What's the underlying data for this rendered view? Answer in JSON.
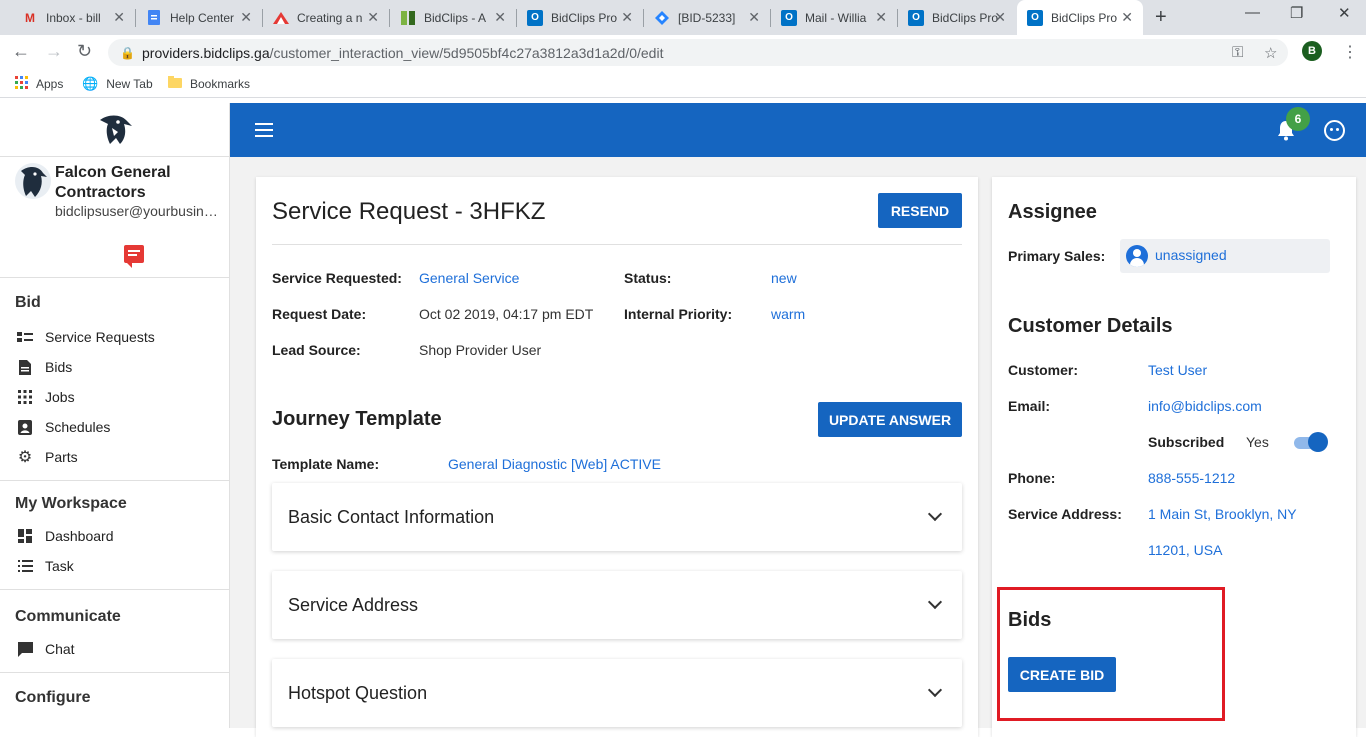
{
  "browser": {
    "tabs": [
      {
        "title": "Inbox - bill",
        "favicon": "gmail-icon"
      },
      {
        "title": "Help Center",
        "favicon": "docs-icon"
      },
      {
        "title": "Creating a n",
        "favicon": "triangle-icon"
      },
      {
        "title": "BidClips - A",
        "favicon": "bidclips-icon"
      },
      {
        "title": "BidClips Pro",
        "favicon": "outlook-icon"
      },
      {
        "title": "[BID-5233]",
        "favicon": "jira-icon"
      },
      {
        "title": "Mail - Willia",
        "favicon": "outlook-icon"
      },
      {
        "title": "BidClips Pro",
        "favicon": "outlook-icon"
      },
      {
        "title": "BidClips Pro",
        "favicon": "outlook-icon"
      }
    ],
    "url_host": "providers.bidclips.ga",
    "url_path": "/customer_interaction_view/5d9505bf4c27a3812a3d1a2d/0/edit",
    "profile_initial": "B",
    "bookmarks": [
      {
        "label": "Apps",
        "icon": "apps-grid-icon"
      },
      {
        "label": "New Tab",
        "icon": "globe-icon"
      },
      {
        "label": "Bookmarks",
        "icon": "folder-icon"
      }
    ]
  },
  "sidebar": {
    "company": "Falcon General Contractors",
    "email": "bidclipsuser@yourbusiness.com",
    "sections": [
      {
        "title": "Bid",
        "items": [
          {
            "label": "Service Requests",
            "icon": "list-icon"
          },
          {
            "label": "Bids",
            "icon": "document-icon"
          },
          {
            "label": "Jobs",
            "icon": "grid-icon"
          },
          {
            "label": "Schedules",
            "icon": "contact-icon"
          },
          {
            "label": "Parts",
            "icon": "gear-icon"
          }
        ]
      },
      {
        "title": "My Workspace",
        "items": [
          {
            "label": "Dashboard",
            "icon": "dashboard-icon"
          },
          {
            "label": "Task",
            "icon": "task-list-icon"
          }
        ]
      },
      {
        "title": "Communicate",
        "items": [
          {
            "label": "Chat",
            "icon": "chat-icon"
          }
        ]
      },
      {
        "title": "Configure",
        "items": []
      }
    ]
  },
  "topbar": {
    "notification_count": "6",
    "accent": "#1565c0"
  },
  "request": {
    "title": "Service Request - 3HFKZ",
    "resend_label": "RESEND",
    "fields": {
      "service_requested_label": "Service Requested:",
      "service_requested_value": "General Service",
      "status_label": "Status:",
      "status_value": "new",
      "request_date_label": "Request Date:",
      "request_date_value": "Oct 02 2019, 04:17 pm EDT",
      "priority_label": "Internal Priority:",
      "priority_value": "warm",
      "lead_source_label": "Lead Source:",
      "lead_source_value": "Shop Provider User"
    },
    "journey": {
      "title": "Journey Template",
      "update_label": "UPDATE ANSWER",
      "template_label": "Template Name:",
      "template_value": "General Diagnostic [Web] ACTIVE"
    },
    "accordions": [
      "Basic Contact Information",
      "Service Address",
      "Hotspot Question"
    ]
  },
  "side": {
    "assignee_title": "Assignee",
    "primary_sales_label": "Primary Sales:",
    "primary_sales_value": "unassigned",
    "customer_title": "Customer Details",
    "customer_label": "Customer:",
    "customer_value": "Test User",
    "email_label": "Email:",
    "email_value": "info@bidclips.com",
    "subscribed_label": "Subscribed",
    "subscribed_value": "Yes",
    "phone_label": "Phone:",
    "phone_value": "888-555-1212",
    "address_label": "Service Address:",
    "address_line1": "1 Main St, Brooklyn, NY",
    "address_line2": "11201, USA",
    "bids_title": "Bids",
    "create_bid_label": "CREATE BID"
  }
}
